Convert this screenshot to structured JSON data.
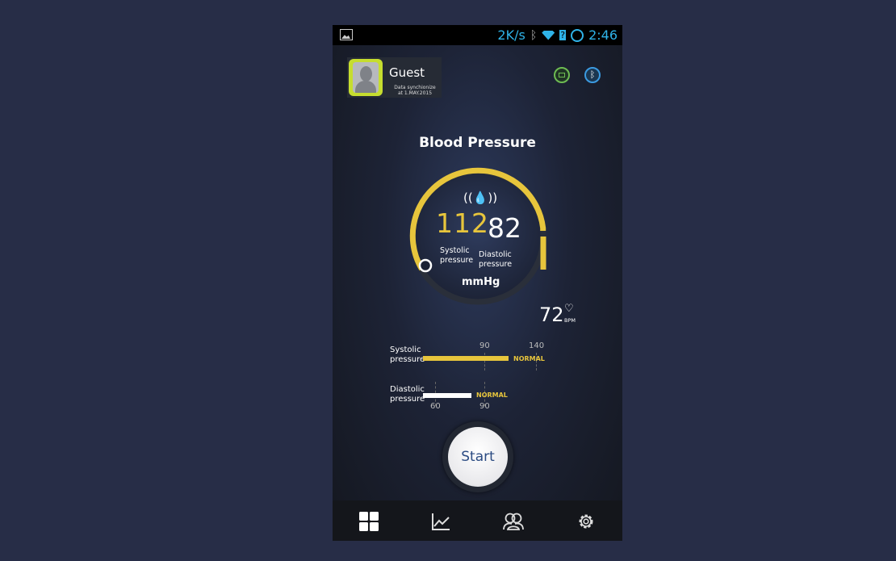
{
  "status_bar": {
    "speed": "2K/s",
    "time": "2:46",
    "icons": [
      "gallery-icon",
      "bluetooth-icon",
      "wifi-icon",
      "sim-icon",
      "sync-circle-icon"
    ]
  },
  "profile": {
    "name": "Guest",
    "sync_line1": "Data synchionize",
    "sync_line2": "at 1.MAY.2015"
  },
  "header_icons": [
    "battery-icon",
    "bluetooth-icon"
  ],
  "title": "Blood Pressure",
  "reading": {
    "systolic": "112",
    "diastolic": "82",
    "systolic_label_1": "Systolic",
    "systolic_label_2": "pressure",
    "diastolic_label_1": "Diastolic",
    "diastolic_label_2": "pressure",
    "unit": "mmHg"
  },
  "pulse": {
    "value": "72",
    "unit": "BPM"
  },
  "bars": {
    "systolic": {
      "label_1": "Systolic",
      "label_2": "pressure",
      "tick_a": "90",
      "tick_b": "140",
      "status": "NORMAL",
      "value": 112
    },
    "diastolic": {
      "label_1": "Diastolic",
      "label_2": "pressure",
      "tick_a": "60",
      "tick_b": "90",
      "status": "NORMAL",
      "value": 82
    }
  },
  "start_label": "Start",
  "nav": [
    {
      "name": "dashboard",
      "icon": "grid-icon",
      "active": true
    },
    {
      "name": "history",
      "icon": "chart-icon",
      "active": false
    },
    {
      "name": "users",
      "icon": "users-icon",
      "active": false
    },
    {
      "name": "settings",
      "icon": "gear-icon",
      "active": false
    }
  ],
  "colors": {
    "accent": "#e7c53c",
    "background": "#272d47",
    "status_blue": "#2fb3e8"
  }
}
